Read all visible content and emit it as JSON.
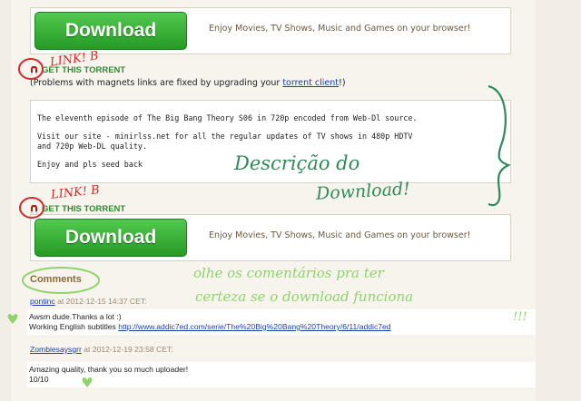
{
  "ad": {
    "button_label": "Download",
    "tagline": "Enjoy Movies, TV Shows, Music and Games on your browser!"
  },
  "torrent": {
    "link_label": "GET THIS TORRENT",
    "magnet_note_prefix": "(Problems with magnets links are fixed by upgrading your ",
    "magnet_note_link": "torrent client",
    "magnet_note_suffix": "!)"
  },
  "description": {
    "line1": "The eleventh episode of The Big Bang Theory S06 in 720p encoded from Web-Dl source.",
    "line2": "Visit our site - minirlss.net for all the regular updates of TV shows in 480p HDTV\nand 720p Web-DL quality.",
    "line3": "Enjoy and pls seed back"
  },
  "comments": {
    "heading": "Comments",
    "items": [
      {
        "user": "pontinc",
        "date": "at 2012-12-15 14:37 CET:",
        "line1": "Awsm dude.Thanks a lot :)",
        "line2_prefix": "Working English subtitles ",
        "line2_link": "http://www.addic7ed.com/serie/The%20Big%20Bang%20Theory/6/11/addic7ed"
      },
      {
        "user": "Zombiesaysgrr",
        "date": "at 2012-12-19 23:58 CET:",
        "line1": "Amazing quality, thank you so much uploader!",
        "line2": "10/10"
      }
    ]
  },
  "handwritten": {
    "link_note_1": "LINK! B",
    "link_note_2": "LINK! B",
    "description_note_1": "Descrição do",
    "description_note_2": "Download!",
    "comments_note_1": "olhe os comentários pra ter",
    "comments_note_2": "certeza se o download funciona",
    "exclaim": "!!!"
  },
  "colors": {
    "annotation_red": "#d42a2a",
    "annotation_green": "#2f8a5a",
    "highlight_green": "#8fd36a",
    "button_green": "#34b335"
  }
}
